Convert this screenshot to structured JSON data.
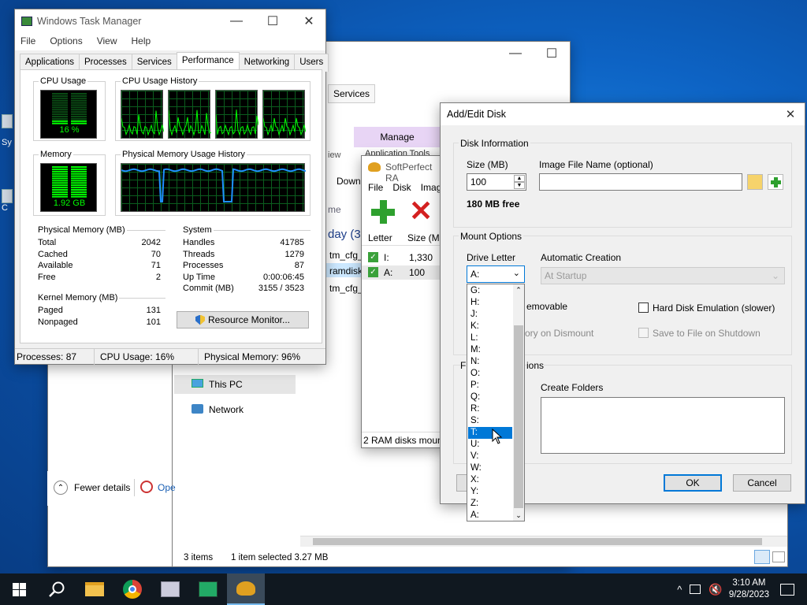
{
  "task_manager": {
    "title": "Windows Task Manager",
    "menu": [
      "File",
      "Options",
      "View",
      "Help"
    ],
    "tabs": [
      "Applications",
      "Processes",
      "Services",
      "Performance",
      "Networking",
      "Users"
    ],
    "cpu_usage_label": "CPU Usage",
    "cpu_usage_value": "16 %",
    "cpu_history_label": "CPU Usage History",
    "memory_label": "Memory",
    "memory_value": "1.92 GB",
    "pmem_history_label": "Physical Memory Usage History",
    "physical_memory": {
      "title": "Physical Memory (MB)",
      "rows": [
        [
          "Total",
          "2042"
        ],
        [
          "Cached",
          "70"
        ],
        [
          "Available",
          "71"
        ],
        [
          "Free",
          "2"
        ]
      ]
    },
    "system": {
      "title": "System",
      "rows": [
        [
          "Handles",
          "41785"
        ],
        [
          "Threads",
          "1279"
        ],
        [
          "Processes",
          "87"
        ],
        [
          "Up Time",
          "0:00:06:45"
        ],
        [
          "Commit (MB)",
          "3155 / 3523"
        ]
      ]
    },
    "kernel_memory": {
      "title": "Kernel Memory (MB)",
      "rows": [
        [
          "Paged",
          "131"
        ],
        [
          "Nonpaged",
          "101"
        ]
      ]
    },
    "resource_monitor_button": "Resource Monitor...",
    "status": [
      "Processes: 87",
      "CPU Usage: 16%",
      "Physical Memory: 96%"
    ]
  },
  "explorer": {
    "services_tab": "Services",
    "manage_tab": "Manage",
    "ribbon_partial": "Application Tools",
    "view_partial": "iew",
    "download_partial": "Down",
    "name_partial": "me",
    "group_partial": "day (3",
    "files_partial": [
      "tm_cfg_",
      "ramdisk",
      "tm_cfg_"
    ],
    "nav_this_pc": "This PC",
    "nav_network": "Network",
    "fewer_details": "Fewer details",
    "open_partial": "Ope",
    "status_items": "3 items",
    "status_selected": "1 item selected  3.27 MB"
  },
  "ramdisk": {
    "title": "SoftPerfect RA",
    "menu": [
      "File",
      "Disk",
      "Imag"
    ],
    "col_letter": "Letter",
    "col_size": "Size (MB",
    "rows": [
      [
        "I:",
        "1,330"
      ],
      [
        "A:",
        "100"
      ]
    ],
    "status": "2 RAM disks moun"
  },
  "dialog": {
    "title": "Add/Edit Disk",
    "disk_info": "Disk Information",
    "size_label": "Size (MB)",
    "size_value": "100",
    "image_label": "Image File Name (optional)",
    "image_value": "",
    "free_text": "180 MB free",
    "mount_options": "Mount Options",
    "drive_letter_label": "Drive Letter",
    "drive_letter_value": "A:",
    "auto_creation_label": "Automatic Creation",
    "auto_creation_value": "At Startup",
    "removable_partial": "emovable",
    "hard_disk_emulation": "Hard Disk Emulation (slower)",
    "dismount_partial": "ory on Dismount",
    "save_on_shutdown": "Save to File on Shutdown",
    "fs_partial_left": "Fi",
    "fs_partial_right": "ions",
    "create_folders": "Create Folders",
    "ok": "OK",
    "cancel": "Cancel",
    "drive_options": [
      "G:",
      "H:",
      "J:",
      "K:",
      "L:",
      "M:",
      "N:",
      "O:",
      "P:",
      "Q:",
      "R:",
      "S:",
      "T:",
      "U:",
      "V:",
      "W:",
      "X:",
      "Y:",
      "Z:",
      "A:"
    ],
    "selected_option": "T:"
  },
  "taskbar": {
    "time": "3:10 AM",
    "date": "9/28/2023"
  },
  "colors": {
    "graph_green": "#00ff00",
    "graph_blue": "#1e90ff",
    "accent": "#0078d7"
  }
}
